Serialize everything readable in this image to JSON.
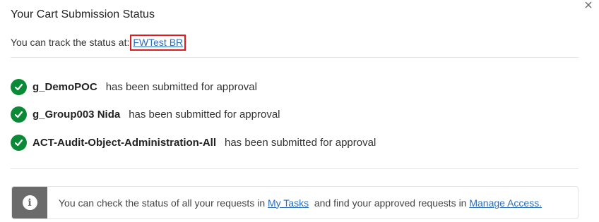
{
  "dialog": {
    "title": "Your Cart Submission Status",
    "track_prefix": "You can track the status at:",
    "track_link": "FWTest BR"
  },
  "items": [
    {
      "name": "g_DemoPOC",
      "status": "has been submitted for approval"
    },
    {
      "name": "g_Group003 Nida",
      "status": "has been submitted for approval"
    },
    {
      "name": "ACT-Audit-Object-Administration-All",
      "status": "has been submitted for approval"
    }
  ],
  "info": {
    "text_before": "You can check the status of all your requests in",
    "link1": "My Tasks",
    "text_middle": "and find your approved requests in",
    "link2": "Manage Access."
  },
  "colors": {
    "success": "#0a8a36",
    "link": "#2a6ebb",
    "highlight_border": "#e0191f",
    "info_bar": "#6b6b6b"
  },
  "icons": {
    "close": "close-icon",
    "check": "check-circle-icon",
    "info": "info-icon"
  }
}
